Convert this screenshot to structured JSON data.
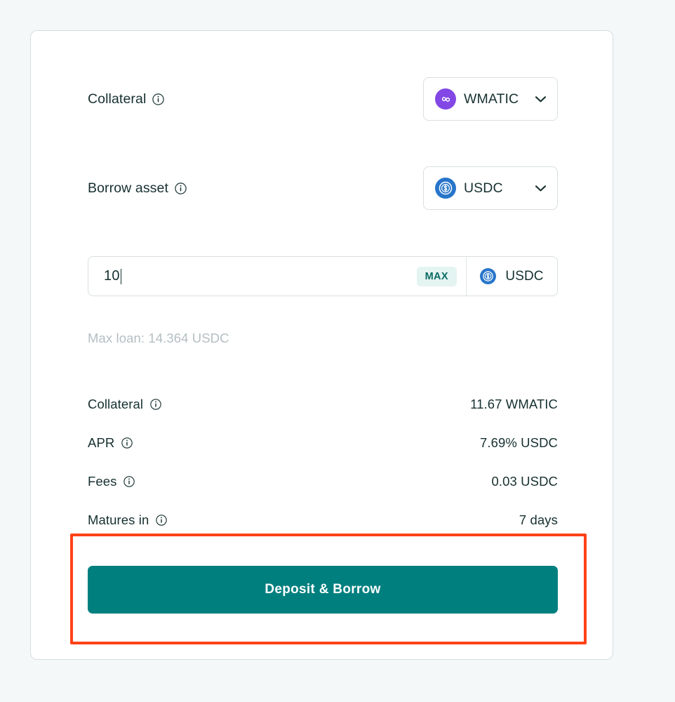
{
  "form": {
    "collateral_field": {
      "label": "Collateral",
      "info_icon": "info-icon",
      "selected": "WMATIC",
      "token_icon": "wmatic-token-icon",
      "chevron_icon": "chevron-down-icon"
    },
    "borrow_field": {
      "label": "Borrow asset",
      "info_icon": "info-icon",
      "selected": "USDC",
      "token_icon": "usdc-token-icon",
      "chevron_icon": "chevron-down-icon"
    },
    "amount_input": {
      "value": "10",
      "placeholder": "0",
      "max_label": "MAX",
      "unit": "USDC",
      "unit_icon": "usdc-token-icon",
      "helper_text": "Max loan: 14.364 USDC"
    }
  },
  "summary": {
    "rows": [
      {
        "label": "Collateral",
        "value": "11.67 WMATIC",
        "info_icon": "info-icon"
      },
      {
        "label": "APR",
        "value": "7.69% USDC",
        "info_icon": "info-icon"
      },
      {
        "label": "Fees",
        "value": "0.03 USDC",
        "info_icon": "info-icon"
      },
      {
        "label": "Matures in",
        "value": "7 days",
        "info_icon": "info-icon"
      }
    ]
  },
  "cta": {
    "label": "Deposit & Borrow"
  },
  "colors": {
    "page_background": "#f4f8f9",
    "card_background": "#ffffff",
    "card_border": "#d6dddf",
    "text_primary": "#16302f",
    "text_muted": "#b3bfc3",
    "accent_teal": "#007f7f",
    "max_badge_background": "#e3f4f1",
    "max_badge_text": "#0b6b63",
    "highlight_border": "#ff4218",
    "wmatic_purple": "#8247e5",
    "usdc_blue": "#2775ca"
  }
}
